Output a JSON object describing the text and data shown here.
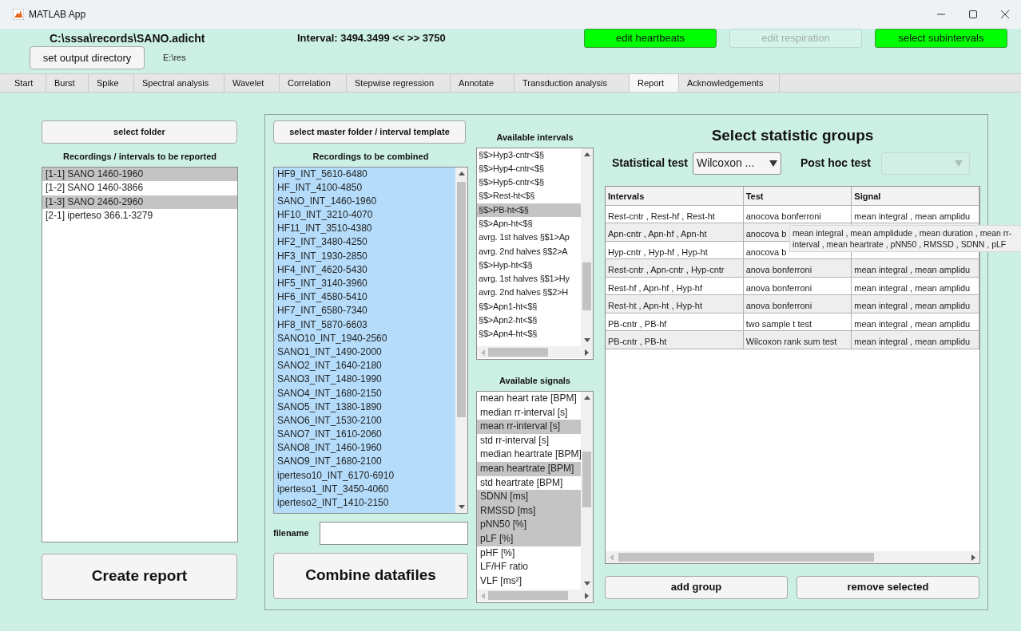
{
  "window": {
    "title": "MATLAB App"
  },
  "header": {
    "file_path": "C:\\sssa\\records\\SANO.adicht",
    "interval": "Interval: 3494.3499 << >> 3750",
    "output_button": "set output directory",
    "output_path": "E:\\res",
    "buttons": [
      {
        "label": "edit heartbeats",
        "disabled": false
      },
      {
        "label": "edit respiration",
        "disabled": true
      },
      {
        "label": "select subintervals",
        "disabled": false
      }
    ]
  },
  "tabs": [
    {
      "label": "Start",
      "selected": false
    },
    {
      "label": "Burst",
      "selected": false
    },
    {
      "label": "Spike",
      "selected": false
    },
    {
      "label": "Spectral analysis",
      "selected": false
    },
    {
      "label": "Wavelet",
      "selected": false
    },
    {
      "label": "Correlation",
      "selected": false
    },
    {
      "label": "Stepwise regression",
      "selected": false
    },
    {
      "label": "Annotate",
      "selected": false
    },
    {
      "label": "Transduction analysis",
      "selected": false
    },
    {
      "label": "Report",
      "selected": true
    },
    {
      "label": "Acknowledgements",
      "selected": false
    }
  ],
  "report": {
    "folder_button": "select folder",
    "list_label": "Recordings / intervals to be reported",
    "recordings": [
      {
        "label": "[1-1] SANO 1460-1960",
        "selected": true
      },
      {
        "label": "[1-2] SANO 1460-3866",
        "selected": false
      },
      {
        "label": "[1-3] SANO 2460-2960",
        "selected": true
      },
      {
        "label": "[2-1] iperteso 366.1-3279",
        "selected": false
      }
    ],
    "create_button": "Create report"
  },
  "combine": {
    "master_button": "select master folder / interval template",
    "list_label": "Recordings to be combined",
    "recordings": [
      {
        "label": "HF9_INT_5610-6480",
        "selected": true
      },
      {
        "label": "HF_INT_4100-4850",
        "selected": true
      },
      {
        "label": "SANO_INT_1460-1960",
        "selected": true
      },
      {
        "label": "HF10_INT_3210-4070",
        "selected": true
      },
      {
        "label": "HF11_INT_3510-4380",
        "selected": true
      },
      {
        "label": "HF2_INT_3480-4250",
        "selected": true
      },
      {
        "label": "HF3_INT_1930-2850",
        "selected": true
      },
      {
        "label": "HF4_INT_4620-5430",
        "selected": true
      },
      {
        "label": "HF5_INT_3140-3960",
        "selected": true
      },
      {
        "label": "HF6_INT_4580-5410",
        "selected": true
      },
      {
        "label": "HF7_INT_6580-7340",
        "selected": true
      },
      {
        "label": "HF8_INT_5870-6603",
        "selected": true
      },
      {
        "label": "SANO10_INT_1940-2560",
        "selected": true
      },
      {
        "label": "SANO1_INT_1490-2000",
        "selected": true
      },
      {
        "label": "SANO2_INT_1640-2180",
        "selected": true
      },
      {
        "label": "SANO3_INT_1480-1990",
        "selected": true
      },
      {
        "label": "SANO4_INT_1680-2150",
        "selected": true
      },
      {
        "label": "SANO5_INT_1380-1890",
        "selected": true
      },
      {
        "label": "SANO6_INT_1530-2100",
        "selected": true
      },
      {
        "label": "SANO7_INT_1610-2060",
        "selected": true
      },
      {
        "label": "SANO8_INT_1460-1960",
        "selected": true
      },
      {
        "label": "SANO9_INT_1680-2100",
        "selected": true
      },
      {
        "label": "iperteso10_INT_6170-6910",
        "selected": true
      },
      {
        "label": "iperteso1_INT_3450-4060",
        "selected": true
      },
      {
        "label": "iperteso2_INT_1410-2150",
        "selected": true
      }
    ],
    "filename_label": "filename",
    "combine_button": "Combine datafiles"
  },
  "intervals": {
    "label": "Available  intervals",
    "items": [
      {
        "label": "§$>Hyp3-cntr<$§",
        "selected": false
      },
      {
        "label": "§$>Hyp4-cntr<$§",
        "selected": false
      },
      {
        "label": "§$>Hyp5-cntr<$§",
        "selected": false
      },
      {
        "label": "§$>Rest-ht<$§",
        "selected": false
      },
      {
        "label": "§$>PB-ht<$§",
        "selected": true
      },
      {
        "label": "§$>Apn-ht<$§",
        "selected": false
      },
      {
        "label": "avrg. 1st halves §$1>Ap",
        "selected": false
      },
      {
        "label": "avrg. 2nd halves §$2>A",
        "selected": false
      },
      {
        "label": "§$>Hyp-ht<$§",
        "selected": false
      },
      {
        "label": "avrg. 1st halves §$1>Hy",
        "selected": false
      },
      {
        "label": "avrg. 2nd halves §$2>H",
        "selected": false
      },
      {
        "label": "§$>Apn1-ht<$§",
        "selected": false
      },
      {
        "label": "§$>Apn2-ht<$§",
        "selected": false
      },
      {
        "label": "§$>Apn4-ht<$§",
        "selected": false
      }
    ]
  },
  "signals": {
    "label": "Available signals",
    "items": [
      {
        "label": "mean heart rate [BPM]",
        "selected": false
      },
      {
        "label": "median rr-interval [s]",
        "selected": false
      },
      {
        "label": "mean rr-interval [s]",
        "selected": true
      },
      {
        "label": "std rr-interval [s]",
        "selected": false
      },
      {
        "label": "median heartrate [BPM]",
        "selected": false
      },
      {
        "label": "mean heartrate [BPM]",
        "selected": true
      },
      {
        "label": "std heartrate [BPM]",
        "selected": false
      },
      {
        "label": "SDNN [ms]",
        "selected": true
      },
      {
        "label": "RMSSD [ms]",
        "selected": true
      },
      {
        "label": "pNN50 [%]",
        "selected": true
      },
      {
        "label": "pLF [%]",
        "selected": true
      },
      {
        "label": "pHF [%]",
        "selected": false
      },
      {
        "label": "LF/HF ratio",
        "selected": false
      },
      {
        "label": "VLF [ms²]",
        "selected": false
      }
    ]
  },
  "statistics": {
    "title": "Select statistic groups",
    "test_label": "Statistical test",
    "test_value": "Wilcoxon ...",
    "posthoc_label": "Post hoc test",
    "posthoc_disabled": true,
    "table": {
      "columns": [
        "Intervals",
        "Test",
        "Signal"
      ],
      "rows": [
        [
          "Rest-cntr , Rest-hf , Rest-ht",
          "anocova bonferroni",
          "mean integral , mean amplidu"
        ],
        [
          "Apn-cntr , Apn-hf , Apn-ht",
          "anocova b",
          null
        ],
        [
          "Hyp-cntr , Hyp-hf , Hyp-ht",
          "anocova b",
          null
        ],
        [
          "Rest-cntr , Apn-cntr , Hyp-cntr",
          "anova bonferroni",
          "mean integral , mean amplidu"
        ],
        [
          "Rest-hf , Apn-hf , Hyp-hf",
          "anova bonferroni",
          "mean integral , mean amplidu"
        ],
        [
          "Rest-ht , Apn-ht , Hyp-ht",
          "anova bonferroni",
          "mean integral , mean amplidu"
        ],
        [
          "PB-cntr , PB-hf",
          "two sample t test",
          "mean integral , mean amplidu"
        ],
        [
          "PB-cntr , PB-ht",
          "Wilcoxon rank sum test",
          "mean integral , mean amplidu"
        ]
      ]
    },
    "tooltip": "mean integral , mean amplidude , mean duration , mean rr-interval , mean heartrate , pNN50 , RMSSD , SDNN , pLF",
    "add_button": "add group",
    "remove_button": "remove selected"
  }
}
